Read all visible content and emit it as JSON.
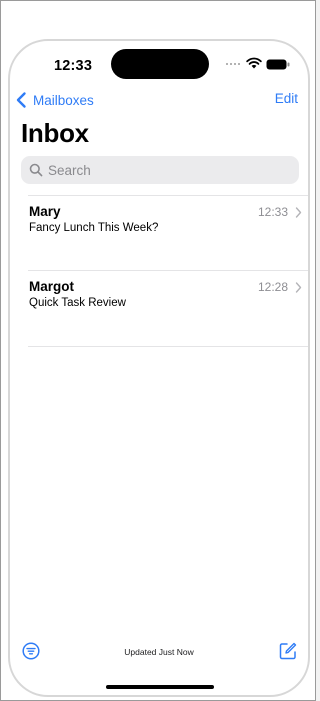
{
  "status_bar": {
    "time": "12:33"
  },
  "nav": {
    "back_label": "Mailboxes",
    "edit_label": "Edit"
  },
  "title": "Inbox",
  "search": {
    "placeholder": "Search"
  },
  "messages": [
    {
      "sender": "Mary",
      "subject": "Fancy Lunch This Week?",
      "time": "12:33"
    },
    {
      "sender": "Margot",
      "subject": "Quick Task Review",
      "time": "12:28"
    }
  ],
  "toolbar": {
    "status": "Updated Just Now"
  },
  "colors": {
    "accent": "#2f7cf6",
    "secondary_text": "#8e8e93",
    "search_bg": "#ebebed",
    "separator": "#e4e4e6"
  },
  "icons": {
    "back": "chevron-left-icon",
    "search": "magnifying-glass-icon",
    "row_disclosure": "chevron-right-icon",
    "filter": "filter-circle-icon",
    "compose": "compose-icon",
    "wifi": "wifi-icon",
    "battery": "battery-icon"
  }
}
